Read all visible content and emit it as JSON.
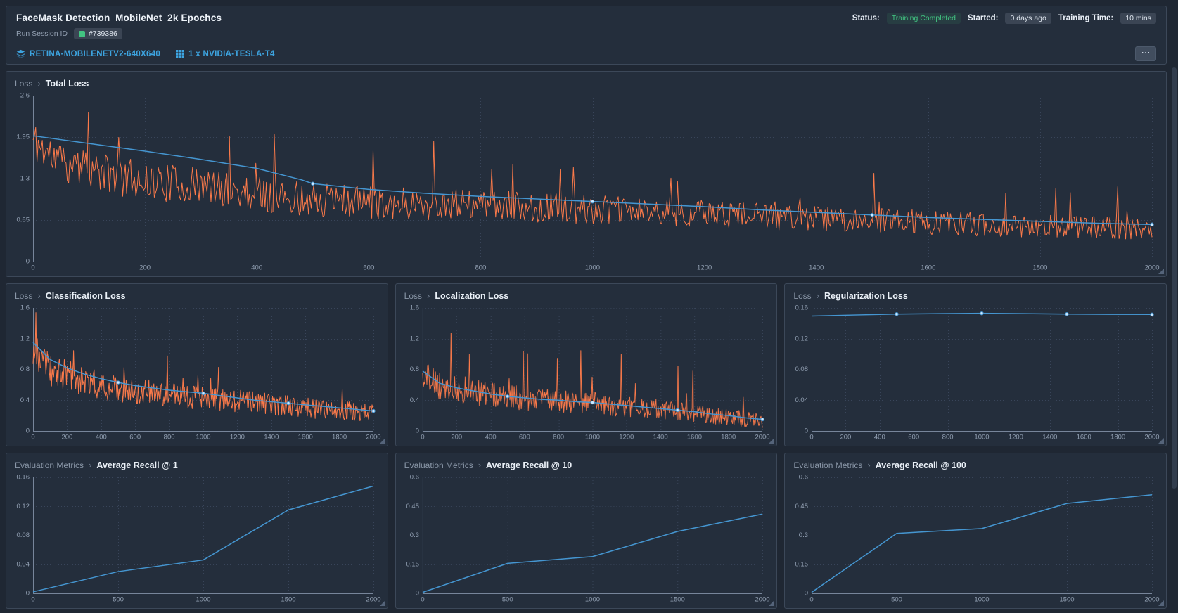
{
  "header": {
    "title": "FaceMask Detection_MobileNet_2k Epochcs",
    "run_session": {
      "label": "Run Session ID",
      "id": "#739386"
    },
    "status": {
      "label": "Status:",
      "value": "Training Completed"
    },
    "started": {
      "label": "Started:",
      "value": "0 days ago"
    },
    "training_time": {
      "label": "Training Time:",
      "value": "10 mins"
    },
    "architecture_link": "RETINA-MOBILENETV2-640X640",
    "gpu_link": "1 x NVIDIA-TESLA-T4",
    "more_button": "⋯"
  },
  "ui": {
    "breadcrumb_sep": "›"
  },
  "colors": {
    "raw_series": "#fb7a4a",
    "smoothed_series": "#4596d1",
    "marker_fill": "#cfe9ff",
    "grid": "#39455a",
    "axis": "#77859a",
    "tick_text": "#93a1b4",
    "accent_green": "#42c482",
    "link_blue": "#3da4e0"
  },
  "chart_data": [
    {
      "type": "line",
      "group": "Loss",
      "title": "Total Loss",
      "xlim": [
        0,
        2000
      ],
      "xticks": [
        0,
        200,
        400,
        600,
        800,
        1000,
        1200,
        1400,
        1600,
        1800,
        2000
      ],
      "ylim": [
        0,
        2.6
      ],
      "yticks": [
        0,
        0.65,
        1.3,
        1.95,
        2.6
      ],
      "series": [
        {
          "name": "raw",
          "kind": "noisy",
          "color": "#fb7a4a",
          "n": 850,
          "seed": 11,
          "trend": [
            [
              0,
              1.9
            ],
            [
              40,
              1.6
            ],
            [
              100,
              1.42
            ],
            [
              200,
              1.27
            ],
            [
              300,
              1.17
            ],
            [
              400,
              1.07
            ],
            [
              500,
              0.97
            ],
            [
              700,
              0.9
            ],
            [
              900,
              0.85
            ],
            [
              1100,
              0.78
            ],
            [
              1300,
              0.71
            ],
            [
              1500,
              0.64
            ],
            [
              1700,
              0.58
            ],
            [
              1900,
              0.53
            ],
            [
              2000,
              0.5
            ]
          ],
          "amp": [
            [
              0,
              0.34
            ],
            [
              200,
              0.3
            ],
            [
              600,
              0.26
            ],
            [
              1200,
              0.21
            ],
            [
              2000,
              0.18
            ]
          ],
          "spike_prob": 0.03,
          "spike": [
            [
              0,
              1.0
            ],
            [
              600,
              1.15
            ],
            [
              1200,
              0.95
            ],
            [
              2000,
              0.7
            ]
          ]
        },
        {
          "name": "smoothed",
          "kind": "line",
          "color": "#4596d1",
          "points": [
            [
              0,
              1.97
            ],
            [
              100,
              1.85
            ],
            [
              200,
              1.73
            ],
            [
              300,
              1.6
            ],
            [
              400,
              1.46
            ],
            [
              480,
              1.28
            ],
            [
              500,
              1.22
            ],
            [
              600,
              1.13
            ],
            [
              700,
              1.07
            ],
            [
              800,
              1.02
            ],
            [
              900,
              0.98
            ],
            [
              1000,
              0.94
            ],
            [
              1100,
              0.9
            ],
            [
              1200,
              0.86
            ],
            [
              1300,
              0.81
            ],
            [
              1400,
              0.77
            ],
            [
              1500,
              0.73
            ],
            [
              1600,
              0.69
            ],
            [
              1700,
              0.66
            ],
            [
              1800,
              0.63
            ],
            [
              1900,
              0.6
            ],
            [
              2000,
              0.58
            ]
          ],
          "markers": [
            500,
            1000,
            1500,
            2000
          ]
        }
      ]
    },
    {
      "type": "line",
      "group": "Loss",
      "title": "Classification Loss",
      "xlim": [
        0,
        2000
      ],
      "xticks": [
        0,
        200,
        400,
        600,
        800,
        1000,
        1200,
        1400,
        1600,
        1800,
        2000
      ],
      "ylim": [
        0,
        1.6
      ],
      "yticks": [
        0,
        0.4,
        0.8,
        1.2,
        1.6
      ],
      "series": [
        {
          "name": "raw",
          "kind": "noisy",
          "color": "#fb7a4a",
          "n": 480,
          "seed": 23,
          "trend": [
            [
              0,
              1.05
            ],
            [
              100,
              0.8
            ],
            [
              300,
              0.65
            ],
            [
              500,
              0.55
            ],
            [
              800,
              0.47
            ],
            [
              1000,
              0.43
            ],
            [
              1300,
              0.37
            ],
            [
              1600,
              0.3
            ],
            [
              2000,
              0.24
            ]
          ],
          "amp": [
            [
              0,
              0.22
            ],
            [
              500,
              0.18
            ],
            [
              1000,
              0.15
            ],
            [
              2000,
              0.12
            ]
          ],
          "spike_prob": 0.03,
          "spike": [
            [
              0,
              0.55
            ],
            [
              600,
              0.5
            ],
            [
              2000,
              0.32
            ]
          ]
        },
        {
          "name": "smoothed",
          "kind": "line",
          "color": "#4596d1",
          "points": [
            [
              0,
              1.15
            ],
            [
              100,
              0.93
            ],
            [
              200,
              0.82
            ],
            [
              300,
              0.74
            ],
            [
              400,
              0.68
            ],
            [
              500,
              0.63
            ],
            [
              600,
              0.59
            ],
            [
              700,
              0.56
            ],
            [
              800,
              0.53
            ],
            [
              900,
              0.51
            ],
            [
              1000,
              0.49
            ],
            [
              1100,
              0.46
            ],
            [
              1200,
              0.43
            ],
            [
              1300,
              0.4
            ],
            [
              1400,
              0.38
            ],
            [
              1500,
              0.36
            ],
            [
              1600,
              0.34
            ],
            [
              1700,
              0.32
            ],
            [
              1800,
              0.3
            ],
            [
              1900,
              0.28
            ],
            [
              2000,
              0.26
            ]
          ],
          "markers": [
            500,
            1000,
            1500,
            2000
          ]
        }
      ]
    },
    {
      "type": "line",
      "group": "Loss",
      "title": "Localization Loss",
      "xlim": [
        0,
        2000
      ],
      "xticks": [
        0,
        200,
        400,
        600,
        800,
        1000,
        1200,
        1400,
        1600,
        1800,
        2000
      ],
      "ylim": [
        0,
        1.6
      ],
      "yticks": [
        0,
        0.4,
        0.8,
        1.2,
        1.6
      ],
      "series": [
        {
          "name": "raw",
          "kind": "noisy",
          "color": "#fb7a4a",
          "n": 480,
          "seed": 37,
          "trend": [
            [
              0,
              0.75
            ],
            [
              100,
              0.58
            ],
            [
              300,
              0.5
            ],
            [
              600,
              0.42
            ],
            [
              1000,
              0.35
            ],
            [
              1400,
              0.28
            ],
            [
              1800,
              0.18
            ],
            [
              2000,
              0.13
            ]
          ],
          "amp": [
            [
              0,
              0.18
            ],
            [
              500,
              0.16
            ],
            [
              1000,
              0.14
            ],
            [
              2000,
              0.1
            ]
          ],
          "spike_prob": 0.03,
          "spike": [
            [
              0,
              0.85
            ],
            [
              600,
              0.75
            ],
            [
              1200,
              0.6
            ],
            [
              2000,
              0.4
            ]
          ]
        },
        {
          "name": "smoothed",
          "kind": "line",
          "color": "#4596d1",
          "points": [
            [
              0,
              0.78
            ],
            [
              100,
              0.62
            ],
            [
              200,
              0.56
            ],
            [
              300,
              0.52
            ],
            [
              400,
              0.48
            ],
            [
              500,
              0.45
            ],
            [
              600,
              0.43
            ],
            [
              700,
              0.41
            ],
            [
              800,
              0.4
            ],
            [
              900,
              0.38
            ],
            [
              1000,
              0.37
            ],
            [
              1100,
              0.35
            ],
            [
              1200,
              0.33
            ],
            [
              1300,
              0.31
            ],
            [
              1400,
              0.29
            ],
            [
              1500,
              0.27
            ],
            [
              1600,
              0.25
            ],
            [
              1700,
              0.22
            ],
            [
              1800,
              0.2
            ],
            [
              1900,
              0.17
            ],
            [
              2000,
              0.15
            ]
          ],
          "markers": [
            500,
            1000,
            1500,
            2000
          ]
        }
      ]
    },
    {
      "type": "line",
      "group": "Loss",
      "title": "Regularization Loss",
      "xlim": [
        0,
        2000
      ],
      "xticks": [
        0,
        200,
        400,
        600,
        800,
        1000,
        1200,
        1400,
        1600,
        1800,
        2000
      ],
      "ylim": [
        0,
        0.16
      ],
      "yticks": [
        0,
        0.04,
        0.08,
        0.12,
        0.16
      ],
      "series": [
        {
          "name": "smoothed",
          "kind": "line",
          "color": "#4596d1",
          "points": [
            [
              0,
              0.1495
            ],
            [
              250,
              0.1508
            ],
            [
              500,
              0.152
            ],
            [
              750,
              0.1526
            ],
            [
              1000,
              0.153
            ],
            [
              1250,
              0.1526
            ],
            [
              1500,
              0.152
            ],
            [
              1750,
              0.1516
            ],
            [
              2000,
              0.1515
            ]
          ],
          "markers": [
            500,
            1000,
            1500,
            2000
          ]
        }
      ]
    },
    {
      "type": "line",
      "group": "Evaluation Metrics",
      "title": "Average Recall @ 1",
      "xlim": [
        0,
        2000
      ],
      "xticks": [
        0,
        500,
        1000,
        1500,
        2000
      ],
      "ylim": [
        0,
        0.16
      ],
      "yticks": [
        0,
        0.04,
        0.08,
        0.12,
        0.16
      ],
      "series": [
        {
          "name": "value",
          "kind": "line",
          "color": "#4596d1",
          "points": [
            [
              0,
              0.002
            ],
            [
              500,
              0.03
            ],
            [
              1000,
              0.046
            ],
            [
              1500,
              0.115
            ],
            [
              2000,
              0.148
            ]
          ],
          "markers": []
        }
      ]
    },
    {
      "type": "line",
      "group": "Evaluation Metrics",
      "title": "Average Recall @ 10",
      "xlim": [
        0,
        2000
      ],
      "xticks": [
        0,
        500,
        1000,
        1500,
        2000
      ],
      "ylim": [
        0,
        0.6
      ],
      "yticks": [
        0,
        0.15,
        0.3,
        0.45,
        0.6
      ],
      "series": [
        {
          "name": "value",
          "kind": "line",
          "color": "#4596d1",
          "points": [
            [
              0,
              0.005
            ],
            [
              500,
              0.155
            ],
            [
              1000,
              0.19
            ],
            [
              1500,
              0.32
            ],
            [
              2000,
              0.41
            ]
          ],
          "markers": []
        }
      ]
    },
    {
      "type": "line",
      "group": "Evaluation Metrics",
      "title": "Average Recall @ 100",
      "xlim": [
        0,
        2000
      ],
      "xticks": [
        0,
        500,
        1000,
        1500,
        2000
      ],
      "ylim": [
        0,
        0.6
      ],
      "yticks": [
        0,
        0.15,
        0.3,
        0.45,
        0.6
      ],
      "series": [
        {
          "name": "value",
          "kind": "line",
          "color": "#4596d1",
          "points": [
            [
              0,
              0.005
            ],
            [
              500,
              0.31
            ],
            [
              1000,
              0.335
            ],
            [
              1500,
              0.465
            ],
            [
              2000,
              0.51
            ]
          ],
          "markers": []
        }
      ]
    }
  ]
}
